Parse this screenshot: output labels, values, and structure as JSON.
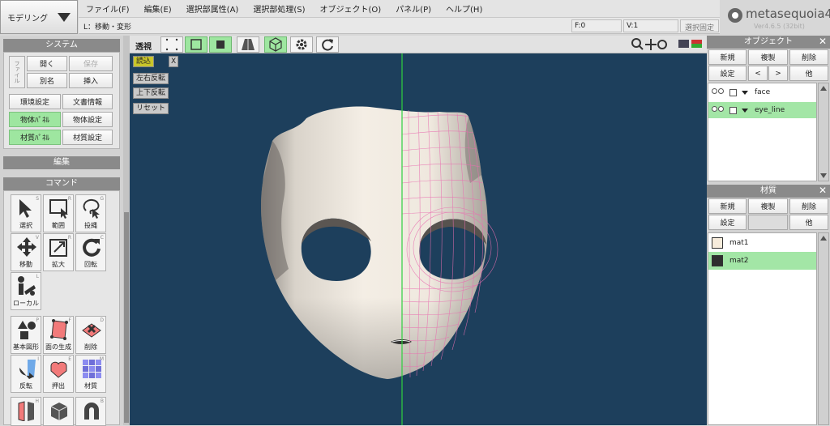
{
  "mode": {
    "label": "モデリング"
  },
  "menu": [
    "ファイル(F)",
    "編集(E)",
    "選択部属性(A)",
    "選択部処理(S)",
    "オブジェクト(O)",
    "パネル(P)",
    "ヘルプ(H)"
  ],
  "status": {
    "text": "L：移動・変形",
    "faces": "F:0",
    "vertices": "V:1",
    "lock": "選択固定"
  },
  "logo": {
    "name": "metasequoia4",
    "version": "Ver4.6.5 (32bit)"
  },
  "system_panel": {
    "title": "システム",
    "file_group": "ファイル",
    "open": "開く",
    "save": "保存",
    "save_as": "別名",
    "insert": "挿入",
    "env": "環境設定",
    "doc_info": "文書情報",
    "obj_panel": "物体ﾊﾟﾈﾙ",
    "obj_settings": "物体設定",
    "mat_panel": "材質ﾊﾟﾈﾙ",
    "mat_settings": "材質設定"
  },
  "edit_panel": {
    "title": "編集"
  },
  "command_panel": {
    "title": "コマンド",
    "tools": [
      {
        "label": "選択",
        "key": "S"
      },
      {
        "label": "範囲",
        "key": "R"
      },
      {
        "label": "投縄",
        "key": "G"
      },
      {
        "label": "移動",
        "key": "V"
      },
      {
        "label": "拡大",
        "key": "R"
      },
      {
        "label": "回転",
        "key": "C"
      },
      {
        "label": "ローカル",
        "key": "L"
      },
      {
        "label": "基本図形",
        "key": "P"
      },
      {
        "label": "面の生成",
        "key": "F"
      },
      {
        "label": "削除",
        "key": "D"
      },
      {
        "label": "反転",
        "key": "I"
      },
      {
        "label": "押出",
        "key": "E"
      },
      {
        "label": "材質",
        "key": "M"
      },
      {
        "label": "",
        "key": "H"
      },
      {
        "label": "",
        "key": ""
      },
      {
        "label": "",
        "key": "B"
      }
    ]
  },
  "viewport": {
    "view_label": "透視",
    "overlay": {
      "load": "読込",
      "close": "X",
      "flip_h": "左右反転",
      "flip_v": "上下反転",
      "reset": "リセット"
    },
    "bg_color": "#1d3f5c",
    "wire_color": "#e86fb0",
    "axis_color": "#2fcf3f"
  },
  "object_panel": {
    "title": "オブジェクト",
    "close": "✕",
    "new": "新規",
    "copy": "複製",
    "delete": "削除",
    "settings": "設定",
    "prev": "<",
    "next": ">",
    "other": "他",
    "items": [
      {
        "name": "face",
        "selected": false
      },
      {
        "name": "eye_line",
        "selected": true
      }
    ]
  },
  "material_panel": {
    "title": "材質",
    "close": "✕",
    "new": "新規",
    "copy": "複製",
    "delete": "削除",
    "settings": "設定",
    "other": "他",
    "items": [
      {
        "name": "mat1",
        "color": "#f7ecdc",
        "selected": false
      },
      {
        "name": "mat2",
        "color": "#2f2f2f",
        "selected": true
      }
    ]
  }
}
